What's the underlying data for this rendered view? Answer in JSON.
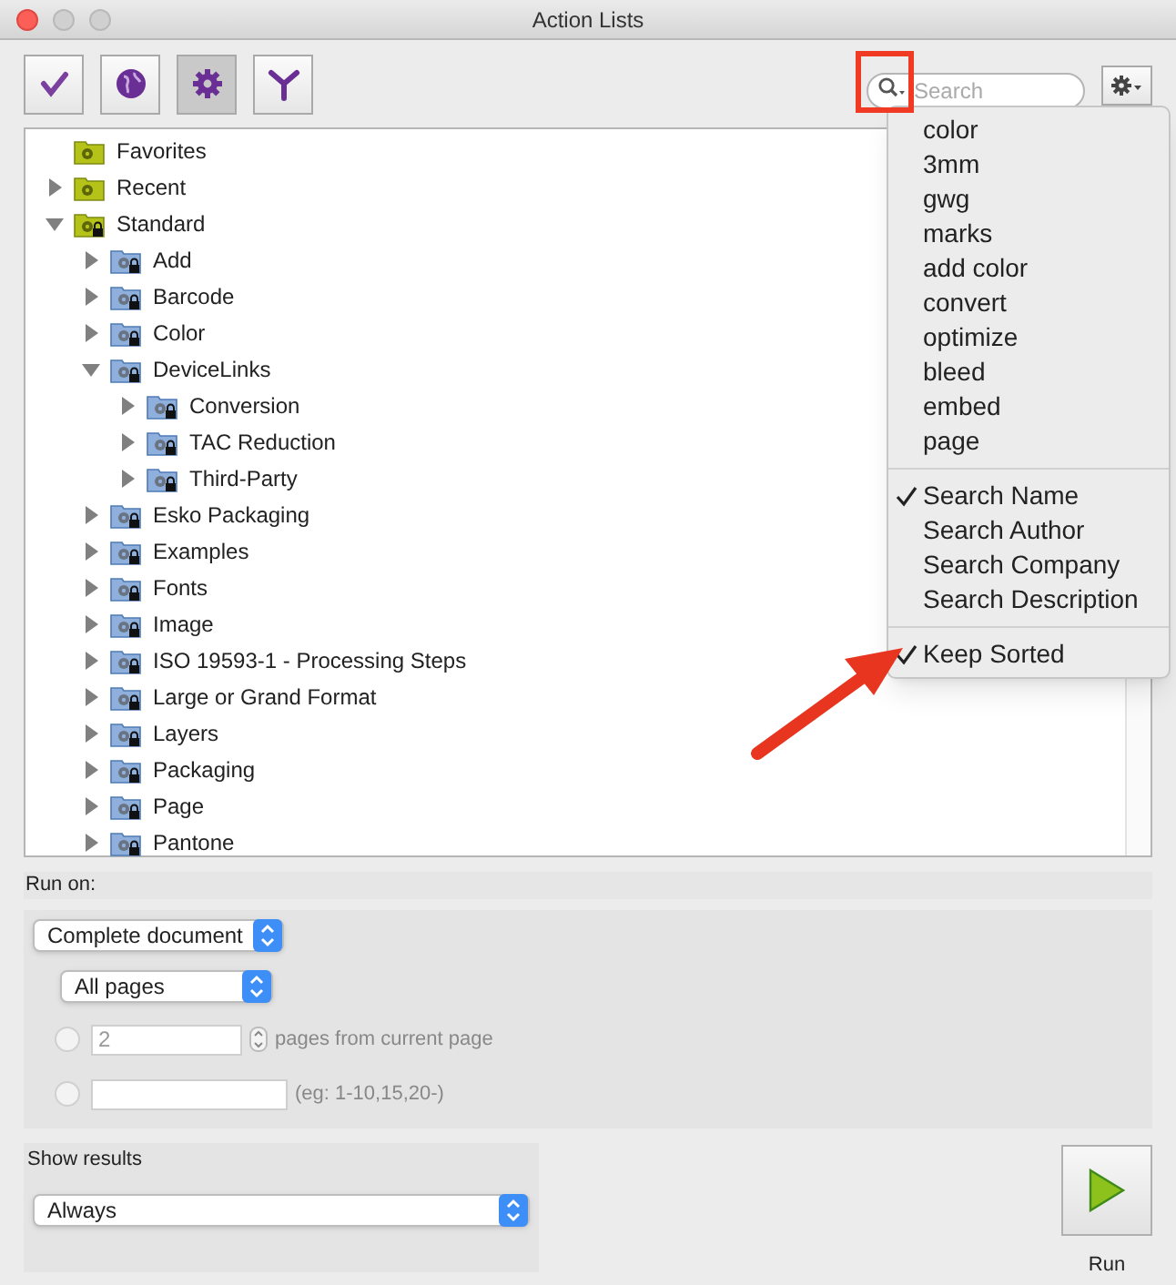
{
  "window": {
    "title": "Action Lists"
  },
  "toolbar": [
    {
      "selected": false
    },
    {
      "selected": false
    },
    {
      "selected": true
    },
    {
      "selected": false
    }
  ],
  "search": {
    "placeholder": "Search"
  },
  "tree": [
    {
      "label": "Favorites",
      "locked": false
    },
    {
      "label": "Recent",
      "locked": false,
      "expanded": false
    },
    {
      "label": "Standard",
      "locked": true,
      "expanded": true,
      "children": [
        {
          "label": "Add",
          "locked": true,
          "expanded": false
        },
        {
          "label": "Barcode",
          "locked": true,
          "expanded": false
        },
        {
          "label": "Color",
          "locked": true,
          "expanded": false
        },
        {
          "label": "DeviceLinks",
          "locked": true,
          "expanded": true,
          "children": [
            {
              "label": "Conversion",
              "locked": true,
              "expanded": false
            },
            {
              "label": "TAC Reduction",
              "locked": true,
              "expanded": false
            },
            {
              "label": "Third-Party",
              "locked": true,
              "expanded": false
            }
          ]
        },
        {
          "label": "Esko Packaging",
          "locked": true,
          "expanded": false
        },
        {
          "label": "Examples",
          "locked": true,
          "expanded": false
        },
        {
          "label": "Fonts",
          "locked": true,
          "expanded": false
        },
        {
          "label": "Image",
          "locked": true,
          "expanded": false
        },
        {
          "label": "ISO 19593-1 - Processing Steps",
          "locked": true,
          "expanded": false
        },
        {
          "label": "Large or Grand Format",
          "locked": true,
          "expanded": false
        },
        {
          "label": "Layers",
          "locked": true,
          "expanded": false
        },
        {
          "label": "Packaging",
          "locked": true,
          "expanded": false
        },
        {
          "label": "Page",
          "locked": true,
          "expanded": false
        },
        {
          "label": "Pantone",
          "locked": true,
          "expanded": false
        }
      ]
    }
  ],
  "search_menu": {
    "recent": [
      "color",
      "3mm",
      "gwg",
      "marks",
      "add color",
      "convert",
      "optimize",
      "bleed",
      "embed",
      "page"
    ],
    "options": [
      {
        "label": "Search Name",
        "checked": true
      },
      {
        "label": "Search Author",
        "checked": false
      },
      {
        "label": "Search Company",
        "checked": false
      },
      {
        "label": "Search Description",
        "checked": false
      }
    ],
    "sorting": [
      {
        "label": "Keep Sorted",
        "checked": true
      }
    ]
  },
  "run_on": {
    "label": "Run on:",
    "scope": "Complete document",
    "pages": "All pages",
    "ranges": [
      {
        "kind": "count",
        "selected": false,
        "value": "2",
        "suffix": "pages from current page"
      },
      {
        "kind": "list",
        "selected": false,
        "suffix": "(eg: 1-10,15,20-)"
      }
    ]
  },
  "show_results": {
    "label": "Show results",
    "value": "Always"
  },
  "run_button": {
    "label": "Run"
  }
}
